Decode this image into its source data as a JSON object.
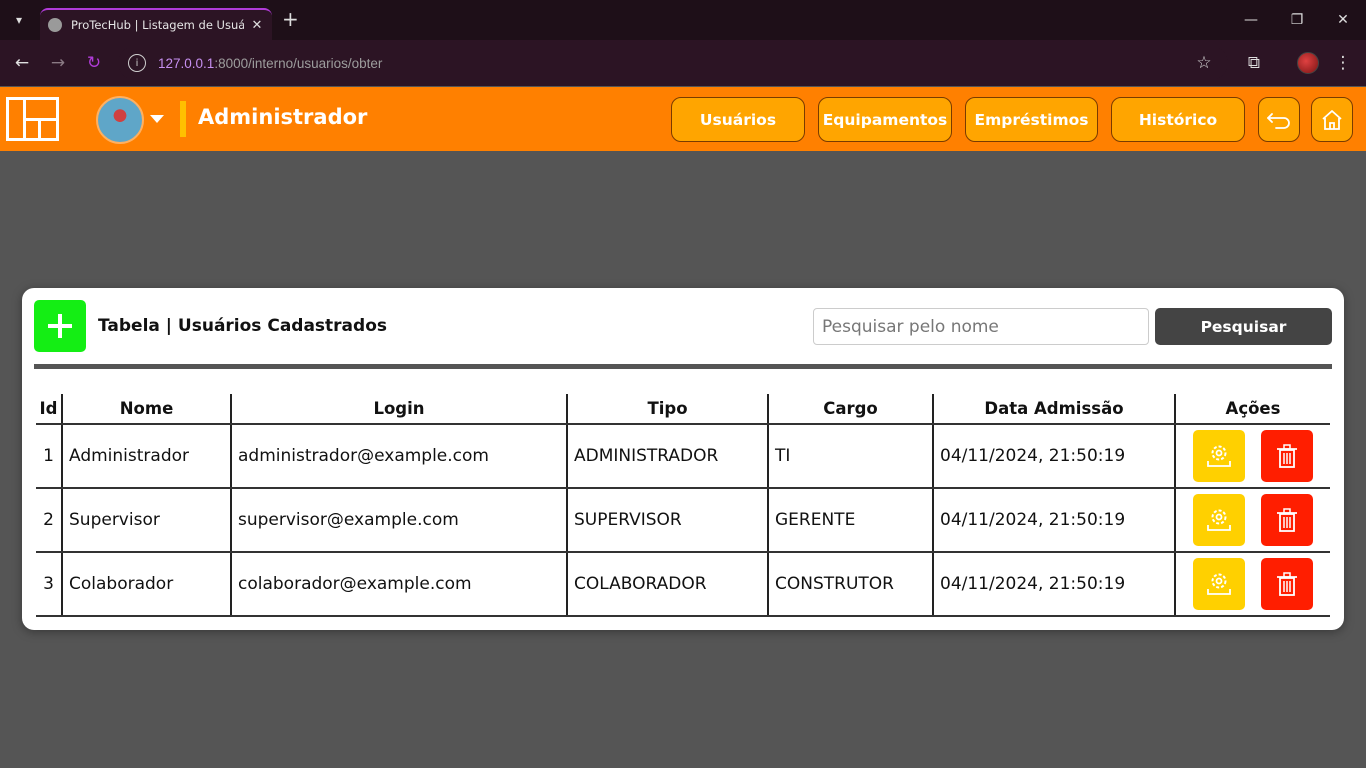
{
  "browser": {
    "tab_title": "ProTecHub | Listagem de Usuários",
    "url_host": "127.0.0.1",
    "url_path": ":8000/interno/usuarios/obter"
  },
  "header": {
    "role": "Administrador",
    "nav": [
      "Usuários",
      "Equipamentos",
      "Empréstimos",
      "Histórico"
    ],
    "accent_color": "#ff8000"
  },
  "card": {
    "title": "Tabela | Usuários Cadastrados",
    "search_placeholder": "Pesquisar pelo nome",
    "search_button": "Pesquisar"
  },
  "table": {
    "headers": [
      "Id",
      "Nome",
      "Login",
      "Tipo",
      "Cargo",
      "Data Admissão",
      "Ações"
    ],
    "rows": [
      {
        "id": "1",
        "nome": "Administrador",
        "login": "administrador@example.com",
        "tipo": "ADMINISTRADOR",
        "cargo": "TI",
        "data": "04/11/2024, 21:50:19"
      },
      {
        "id": "2",
        "nome": "Supervisor",
        "login": "supervisor@example.com",
        "tipo": "SUPERVISOR",
        "cargo": "GERENTE",
        "data": "04/11/2024, 21:50:19"
      },
      {
        "id": "3",
        "nome": "Colaborador",
        "login": "colaborador@example.com",
        "tipo": "COLABORADOR",
        "cargo": "CONSTRUTOR",
        "data": "04/11/2024, 21:50:19"
      }
    ]
  }
}
